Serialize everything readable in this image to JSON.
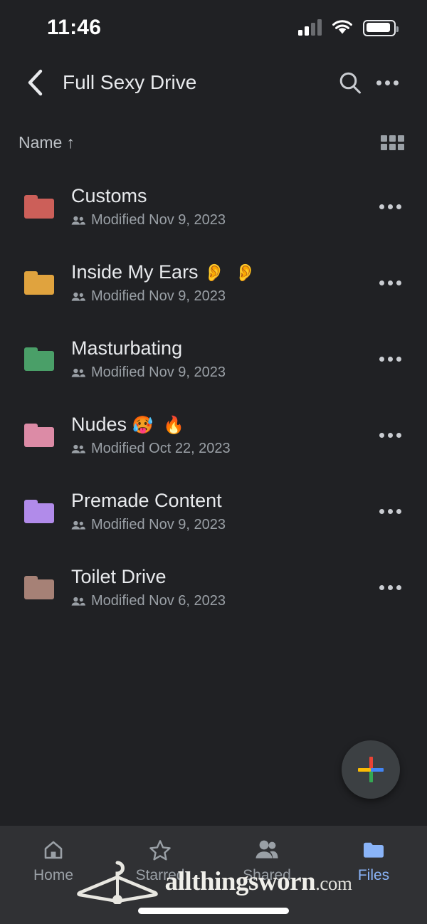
{
  "status_bar": {
    "time": "11:46",
    "signal_icon": "cellular-signal-icon",
    "wifi_icon": "wifi-icon",
    "battery_icon": "battery-icon"
  },
  "app_bar": {
    "back_icon": "back-chevron-icon",
    "title": "Full Sexy Drive",
    "search_icon": "search-icon",
    "overflow_icon": "more-options-icon"
  },
  "sort_bar": {
    "sort_label": "Name",
    "sort_direction_arrow": "↑",
    "view_toggle_icon": "grid-view-icon"
  },
  "files": [
    {
      "name": "Customs",
      "emoji": "",
      "modified": "Modified Nov 9, 2023",
      "shared_icon": "shared-people-icon",
      "folder_icon": "folder-icon",
      "color": "#cc5f59",
      "more_icon": "row-more-options-icon"
    },
    {
      "name": "Inside My Ears",
      "emoji": "👂 👂",
      "modified": "Modified Nov 9, 2023",
      "shared_icon": "shared-people-icon",
      "folder_icon": "folder-icon",
      "color": "#e0a33e",
      "more_icon": "row-more-options-icon"
    },
    {
      "name": "Masturbating",
      "emoji": "",
      "modified": "Modified Nov 9, 2023",
      "shared_icon": "shared-people-icon",
      "folder_icon": "folder-icon",
      "color": "#4a9f68",
      "more_icon": "row-more-options-icon"
    },
    {
      "name": "Nudes",
      "emoji": "🥵 🔥",
      "modified": "Modified Oct 22, 2023",
      "shared_icon": "shared-people-icon",
      "folder_icon": "folder-icon",
      "color": "#dc8ba6",
      "more_icon": "row-more-options-icon"
    },
    {
      "name": "Premade Content",
      "emoji": "",
      "modified": "Modified Nov 9, 2023",
      "shared_icon": "shared-people-icon",
      "folder_icon": "folder-icon",
      "color": "#b18bea",
      "more_icon": "row-more-options-icon"
    },
    {
      "name": "Toilet Drive",
      "emoji": "",
      "modified": "Modified Nov 6, 2023",
      "shared_icon": "shared-people-icon",
      "folder_icon": "folder-icon",
      "color": "#a68176",
      "more_icon": "row-more-options-icon"
    }
  ],
  "fab": {
    "icon": "google-plus-new-icon",
    "colors": {
      "top": "#ea4335",
      "right": "#4285f4",
      "bottom": "#34a853",
      "left": "#fbbc05"
    }
  },
  "bottom_nav": {
    "active_color": "#8ab4f8",
    "items": [
      {
        "label": "Home",
        "icon": "home-icon",
        "active": false
      },
      {
        "label": "Starred",
        "icon": "star-icon",
        "active": false
      },
      {
        "label": "Shared",
        "icon": "people-icon",
        "active": false
      },
      {
        "label": "Files",
        "icon": "folder-icon",
        "active": true
      }
    ]
  },
  "watermark": {
    "logo_icon": "clothes-hanger-icon",
    "brand": "allthingsworn",
    "tld": ".com"
  }
}
